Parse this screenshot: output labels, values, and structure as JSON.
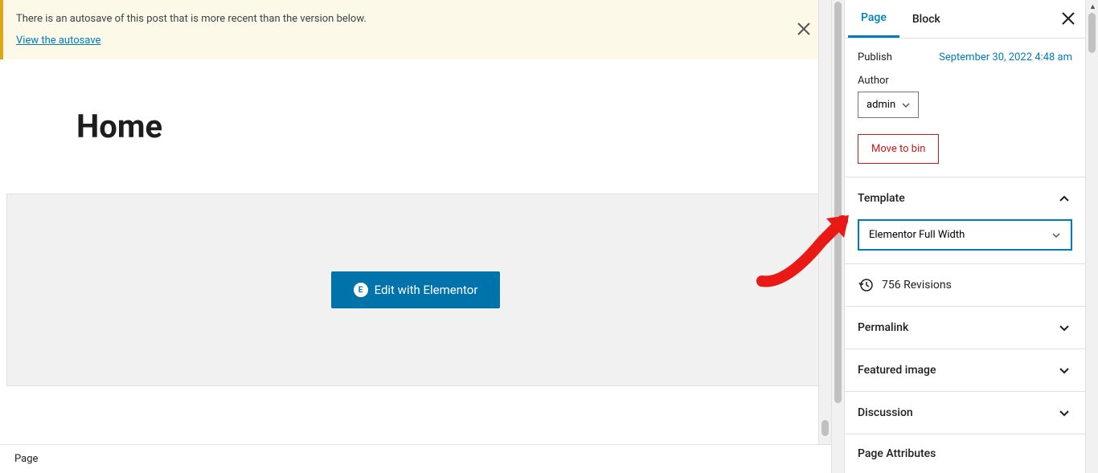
{
  "notice": {
    "text": "There is an autosave of this post that is more recent than the version below.",
    "link": "View the autosave"
  },
  "main": {
    "title": "Home",
    "edit_button": "Edit with Elementor",
    "breadcrumb": "Page"
  },
  "sidebar": {
    "tabs": {
      "page": "Page",
      "block": "Block"
    },
    "publish": {
      "label": "Publish",
      "date": "September 30, 2022 4:48 am"
    },
    "author": {
      "label": "Author",
      "value": "admin"
    },
    "move_to_bin": "Move to bin",
    "template": {
      "title": "Template",
      "selected": "Elementor Full Width"
    },
    "revisions": {
      "count": "756 Revisions"
    },
    "permalink": {
      "title": "Permalink"
    },
    "featured_image": {
      "title": "Featured image"
    },
    "discussion": {
      "title": "Discussion"
    },
    "page_attributes": {
      "title": "Page Attributes"
    }
  }
}
